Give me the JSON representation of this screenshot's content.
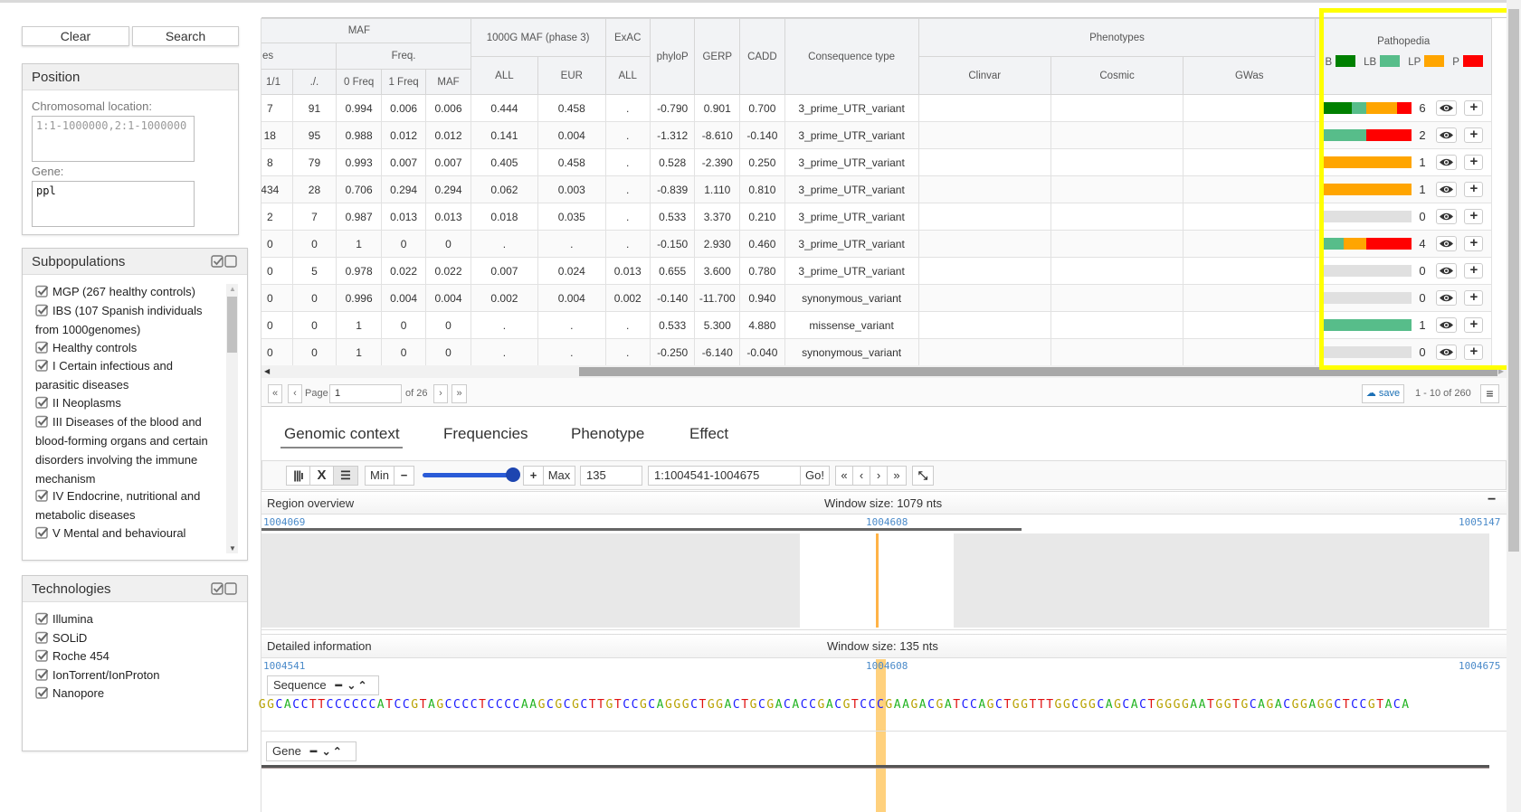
{
  "sidebar": {
    "clear_label": "Clear",
    "search_label": "Search",
    "position": {
      "title": "Position",
      "chrom_label": "Chromosomal location:",
      "chrom_placeholder": "1:1-1000000,2:1-1000000",
      "gene_label": "Gene:",
      "gene_value": "ppl"
    },
    "subpopulations": {
      "title": "Subpopulations",
      "items": [
        {
          "label": "MGP (267 healthy controls)",
          "checked": true
        },
        {
          "label": "IBS (107 Spanish individuals from 1000genomes)",
          "checked": true
        },
        {
          "label": "Healthy controls",
          "checked": true
        },
        {
          "label": "I Certain infectious and parasitic diseases",
          "checked": true
        },
        {
          "label": "II Neoplasms",
          "checked": true
        },
        {
          "label": "III Diseases of the blood and blood-forming organs and certain disorders involving the immune mechanism",
          "checked": true
        },
        {
          "label": "IV Endocrine, nutritional and metabolic diseases",
          "checked": true
        },
        {
          "label": "V Mental and behavioural",
          "checked": true
        }
      ]
    },
    "technologies": {
      "title": "Technologies",
      "items": [
        {
          "label": "Illumina",
          "checked": true
        },
        {
          "label": "SOLiD",
          "checked": true
        },
        {
          "label": "Roche 454",
          "checked": true
        },
        {
          "label": "IonTorrent/IonProton",
          "checked": true
        },
        {
          "label": "Nanopore",
          "checked": true
        }
      ]
    }
  },
  "table": {
    "headers": {
      "maf": "MAF",
      "genotypes_partial": "es",
      "freq": "Freq.",
      "g11": "1/1",
      "missing": "./.",
      "f0": "0 Freq",
      "f1": "1 Freq",
      "maf_sub": "MAF",
      "kg": "1000G MAF (phase 3)",
      "kg_all": "ALL",
      "kg_eur": "EUR",
      "exac": "ExAC",
      "exac_all": "ALL",
      "phylop": "phyloP",
      "gerp": "GERP",
      "cadd": "CADD",
      "consequence": "Consequence type",
      "phenotypes": "Phenotypes",
      "clinvar": "Clinvar",
      "cosmic": "Cosmic",
      "gwas": "GWas",
      "pathopedia": "Pathopedia",
      "legend": [
        {
          "label": "B",
          "color": "#008000"
        },
        {
          "label": "LB",
          "color": "#57bd8a"
        },
        {
          "label": "LP",
          "color": "#ffa500"
        },
        {
          "label": "P",
          "color": "#ff0000"
        }
      ]
    },
    "rows": [
      {
        "g11": "7",
        "missing": "91",
        "f0": "0.994",
        "f1": "0.006",
        "maf": "0.006",
        "kg_all": "0.444",
        "kg_eur": "0.458",
        "exac": ".",
        "phylop": "-0.790",
        "gerp": "0.901",
        "cadd": "0.700",
        "consequence": "3_prime_UTR_variant",
        "clinvar": "",
        "cosmic": "",
        "gwas": "",
        "patho": {
          "B": 2,
          "LB": 1,
          "LP": 2,
          "P": 1,
          "total": "6"
        }
      },
      {
        "g11": "18",
        "missing": "95",
        "f0": "0.988",
        "f1": "0.012",
        "maf": "0.012",
        "kg_all": "0.141",
        "kg_eur": "0.004",
        "exac": ".",
        "phylop": "-1.312",
        "gerp": "-8.610",
        "cadd": "-0.140",
        "consequence": "3_prime_UTR_variant",
        "clinvar": "",
        "cosmic": "",
        "gwas": "",
        "patho": {
          "B": 0,
          "LB": 1,
          "LP": 0,
          "P": 1,
          "total": "2"
        }
      },
      {
        "g11": "8",
        "missing": "79",
        "f0": "0.993",
        "f1": "0.007",
        "maf": "0.007",
        "kg_all": "0.405",
        "kg_eur": "0.458",
        "exac": ".",
        "phylop": "0.528",
        "gerp": "-2.390",
        "cadd": "0.250",
        "consequence": "3_prime_UTR_variant",
        "clinvar": "",
        "cosmic": "",
        "gwas": "",
        "patho": {
          "B": 0,
          "LB": 0,
          "LP": 1,
          "P": 0,
          "total": "1"
        }
      },
      {
        "g11": "434",
        "missing": "28",
        "f0": "0.706",
        "f1": "0.294",
        "maf": "0.294",
        "kg_all": "0.062",
        "kg_eur": "0.003",
        "exac": ".",
        "phylop": "-0.839",
        "gerp": "1.110",
        "cadd": "0.810",
        "consequence": "3_prime_UTR_variant",
        "clinvar": "",
        "cosmic": "",
        "gwas": "",
        "patho": {
          "B": 0,
          "LB": 0,
          "LP": 1,
          "P": 0,
          "total": "1"
        }
      },
      {
        "g11": "2",
        "missing": "7",
        "f0": "0.987",
        "f1": "0.013",
        "maf": "0.013",
        "kg_all": "0.018",
        "kg_eur": "0.035",
        "exac": ".",
        "phylop": "0.533",
        "gerp": "3.370",
        "cadd": "0.210",
        "consequence": "3_prime_UTR_variant",
        "clinvar": "",
        "cosmic": "",
        "gwas": "",
        "patho": {
          "B": 0,
          "LB": 0,
          "LP": 0,
          "P": 0,
          "total": "0"
        }
      },
      {
        "g11": "0",
        "missing": "0",
        "f0": "1",
        "f1": "0",
        "maf": "0",
        "kg_all": ".",
        "kg_eur": ".",
        "exac": ".",
        "phylop": "-0.150",
        "gerp": "2.930",
        "cadd": "0.460",
        "consequence": "3_prime_UTR_variant",
        "clinvar": "",
        "cosmic": "",
        "gwas": "",
        "patho": {
          "B": 0,
          "LB": 1,
          "LP": 1,
          "P": 2,
          "total": "4"
        }
      },
      {
        "g11": "0",
        "missing": "5",
        "f0": "0.978",
        "f1": "0.022",
        "maf": "0.022",
        "kg_all": "0.007",
        "kg_eur": "0.024",
        "exac": "0.013",
        "phylop": "0.655",
        "gerp": "3.600",
        "cadd": "0.780",
        "consequence": "3_prime_UTR_variant",
        "clinvar": "",
        "cosmic": "",
        "gwas": "",
        "patho": {
          "B": 0,
          "LB": 0,
          "LP": 0,
          "P": 0,
          "total": "0"
        }
      },
      {
        "g11": "0",
        "missing": "0",
        "f0": "0.996",
        "f1": "0.004",
        "maf": "0.004",
        "kg_all": "0.002",
        "kg_eur": "0.004",
        "exac": "0.002",
        "phylop": "-0.140",
        "gerp": "-11.700",
        "cadd": "0.940",
        "consequence": "synonymous_variant",
        "clinvar": "",
        "cosmic": "",
        "gwas": "",
        "patho": {
          "B": 0,
          "LB": 0,
          "LP": 0,
          "P": 0,
          "total": "0"
        }
      },
      {
        "g11": "0",
        "missing": "0",
        "f0": "1",
        "f1": "0",
        "maf": "0",
        "kg_all": ".",
        "kg_eur": ".",
        "exac": ".",
        "phylop": "0.533",
        "gerp": "5.300",
        "cadd": "4.880",
        "consequence": "missense_variant",
        "clinvar": "",
        "cosmic": "",
        "gwas": "",
        "patho": {
          "B": 0,
          "LB": 1,
          "LP": 0,
          "P": 0,
          "total": "1"
        }
      },
      {
        "g11": "0",
        "missing": "0",
        "f0": "1",
        "f1": "0",
        "maf": "0",
        "kg_all": ".",
        "kg_eur": ".",
        "exac": ".",
        "phylop": "-0.250",
        "gerp": "-6.140",
        "cadd": "-0.040",
        "consequence": "synonymous_variant",
        "clinvar": "",
        "cosmic": "",
        "gwas": "",
        "patho": {
          "B": 0,
          "LB": 0,
          "LP": 0,
          "P": 0,
          "total": "0"
        }
      }
    ],
    "highlight_color": "#ffff00"
  },
  "pagination": {
    "page_label": "Page",
    "page_value": "1",
    "of_label": "of 26",
    "save_label": "save",
    "range_label": "1 - 10 of 260"
  },
  "tabs": [
    {
      "label": "Genomic context",
      "active": true
    },
    {
      "label": "Frequencies"
    },
    {
      "label": "Phenotype"
    },
    {
      "label": "Effect"
    }
  ],
  "genome": {
    "min_label": "Min",
    "max_label": "Max",
    "zoom_percent": 100,
    "window_value": "135",
    "region_value": "1:1004541-1004675",
    "go_label": "Go!",
    "overview": {
      "title": "Region overview",
      "window": "Window size: 1079 nts",
      "start": "1004069",
      "center": "1004608",
      "end": "1005147"
    },
    "detail": {
      "title": "Detailed information",
      "window": "Window size: 135 nts",
      "start": "1004541",
      "center": "1004608",
      "end": "1004675"
    },
    "sequence_label": "Sequence",
    "gene_label": "Gene",
    "sequence": "GGCACCTTCCCCCCATCCGTAGCCCCTCCCCAAGCGCGCTTGTCCGCAGGGCTGGACTGCGACACCGACGTCCCGAAGACGATCCAGCTGGTTTGGCGGCAGCACTGGGGAATGGTGCAGACGGAGGCTCCGTACA",
    "nucleotide_colors": {
      "A": "#22b422",
      "C": "#1a1aff",
      "G": "#b8a200",
      "T": "#e01010"
    },
    "highlight_color": "#ffc966"
  }
}
